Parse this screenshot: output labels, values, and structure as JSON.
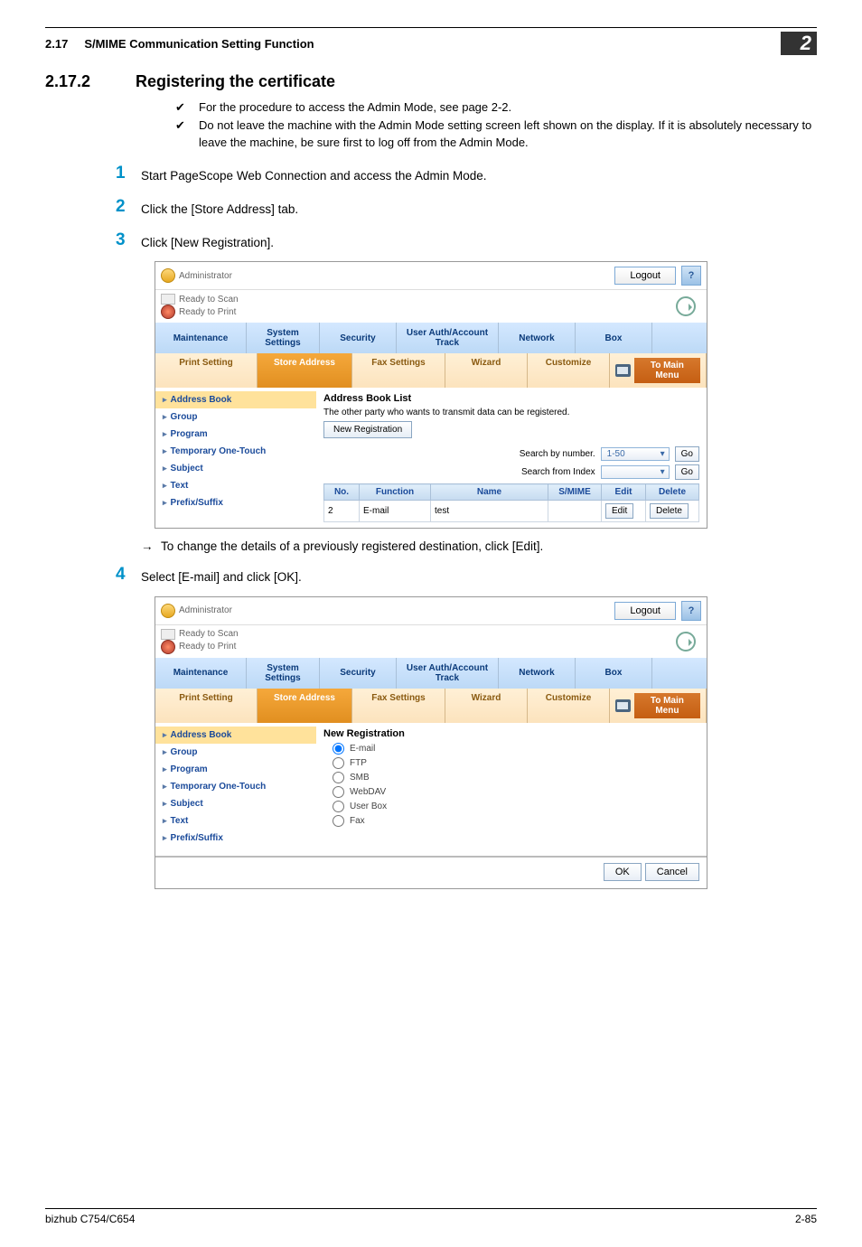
{
  "header": {
    "section_num": "2.17",
    "section_title": "S/MIME Communication Setting Function",
    "chapter_badge": "2"
  },
  "heading": {
    "num": "2.17.2",
    "text": "Registering the certificate"
  },
  "notes": {
    "n1": "For the procedure to access the Admin Mode, see page 2-2.",
    "n2": "Do not leave the machine with the Admin Mode setting screen left shown on the display. If it is absolutely necessary to leave the machine, be sure first to log off from the Admin Mode."
  },
  "steps": {
    "s1": "Start PageScope Web Connection and access the Admin Mode.",
    "s2": "Click the [Store Address] tab.",
    "s3": "Click [New Registration].",
    "s3_sub": "To change the details of a previously registered destination, click [Edit].",
    "s4": "Select [E-mail] and click [OK]."
  },
  "common": {
    "admin": "Administrator",
    "ready_scan": "Ready to Scan",
    "ready_print": "Ready to Print",
    "logout": "Logout",
    "help": "?",
    "tabs": {
      "maintenance": "Maintenance",
      "system": "System Settings",
      "security": "Security",
      "auth": "User Auth/Account Track",
      "network": "Network",
      "box": "Box"
    },
    "subtabs": {
      "print_setting": "Print Setting",
      "store_address": "Store Address",
      "fax_settings": "Fax Settings",
      "wizard": "Wizard",
      "customize": "Customize",
      "to_main": "To Main Menu"
    },
    "side": {
      "address_book": "Address Book",
      "group": "Group",
      "program": "Program",
      "temp": "Temporary One-Touch",
      "subject": "Subject",
      "text": "Text",
      "prefix": "Prefix/Suffix"
    }
  },
  "screen1": {
    "title": "Address Book List",
    "desc": "The other party who wants to transmit data can be registered.",
    "newreg": "New Registration",
    "search_number": "Search by number.",
    "range": "1-50",
    "search_index": "Search from Index",
    "go": "Go",
    "th_no": "No.",
    "th_func": "Function",
    "th_name": "Name",
    "th_smime": "S/MIME",
    "th_edit": "Edit",
    "th_delete": "Delete",
    "row_no": "2",
    "row_func": "E-mail",
    "row_name": "test",
    "row_edit": "Edit",
    "row_delete": "Delete"
  },
  "screen2": {
    "title": "New Registration",
    "opt_email": "E-mail",
    "opt_ftp": "FTP",
    "opt_smb": "SMB",
    "opt_webdav": "WebDAV",
    "opt_userbox": "User Box",
    "opt_fax": "Fax",
    "ok": "OK",
    "cancel": "Cancel"
  },
  "footer": {
    "model": "bizhub C754/C654",
    "page": "2-85"
  }
}
